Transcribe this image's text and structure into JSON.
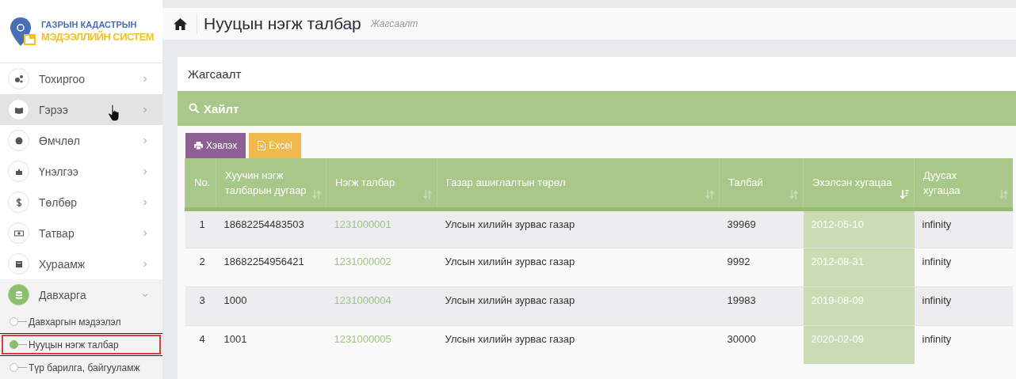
{
  "sidebar": {
    "logo": {
      "line1": "ГАЗРЫН КАДАСТРЫН",
      "line2": "МЭДЭЭЛЛИЙН СИСТЕМ"
    },
    "items": [
      {
        "label": "Тохиргоо",
        "hovered": false,
        "expanded": false
      },
      {
        "label": "Гэрээ",
        "hovered": true,
        "expanded": false
      },
      {
        "label": "Өмчлөл",
        "hovered": false,
        "expanded": false
      },
      {
        "label": "Үнэлгээ",
        "hovered": false,
        "expanded": false
      },
      {
        "label": "Төлбөр",
        "hovered": false,
        "expanded": false
      },
      {
        "label": "Татвар",
        "hovered": false,
        "expanded": false
      },
      {
        "label": "Хураамж",
        "hovered": false,
        "expanded": false
      },
      {
        "label": "Давхарга",
        "hovered": false,
        "expanded": true,
        "children": [
          {
            "label": "Давхаргын мэдээлэл",
            "selected": false
          },
          {
            "label": "Нууцын нэгж талбар",
            "selected": true
          },
          {
            "label": "Түр барилга, байгууламж",
            "selected": false
          }
        ]
      }
    ]
  },
  "header": {
    "title": "Нууцын нэгж талбар",
    "subtitle": "Жагсаалт"
  },
  "card": {
    "title": "Жагсаалт",
    "search_title": "Хайлт",
    "buttons": [
      {
        "label": "Хэвлэх",
        "kind": "print"
      },
      {
        "label": "Excel",
        "kind": "excel"
      }
    ]
  },
  "table": {
    "columns": [
      {
        "label": "No.",
        "kind": "text",
        "sortable": false
      },
      {
        "label": "Хуучин нэгж талбарын дугаар",
        "kind": "text",
        "sortable": true,
        "sorted": false
      },
      {
        "label": "Нэгж талбар",
        "kind": "link",
        "sortable": true,
        "sorted": false
      },
      {
        "label": "Газар ашиглалтын төрөл",
        "kind": "text",
        "sortable": true,
        "sorted": false
      },
      {
        "label": "Талбай",
        "kind": "text",
        "sortable": true,
        "sorted": false
      },
      {
        "label": "Эхэлсэн хугацаа",
        "kind": "text",
        "sortable": true,
        "sorted": true
      },
      {
        "label": "Дуусах хугацаа",
        "kind": "text",
        "sortable": true,
        "sorted": false
      }
    ],
    "rows": [
      [
        "1",
        "18682254483503",
        "1231000001",
        "Улсын хилийн зурвас газар",
        "39969",
        "2012-05-10",
        "infinity"
      ],
      [
        "2",
        "18682254956421",
        "1231000002",
        "Улсын хилийн зурвас газар",
        "9992",
        "2012-08-31",
        "infinity"
      ],
      [
        "3",
        "1000",
        "1231000004",
        "Улсын хилийн зурвас газар",
        "19983",
        "2019-08-09",
        "infinity"
      ],
      [
        "4",
        "1001",
        "1231000005",
        "Улсын хилийн зурвас газар",
        "30000",
        "2020-02-09",
        "infinity"
      ]
    ]
  }
}
